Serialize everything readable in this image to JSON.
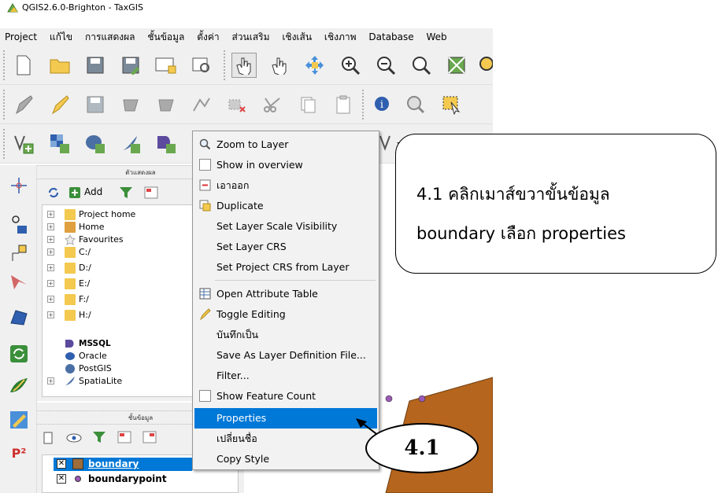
{
  "window": {
    "title": "QGIS2.6.0-Brighton - TaxGIS"
  },
  "menubar": {
    "items": [
      "Project",
      "แก้ไข",
      "การแสดงผล",
      "ชั้นข้อมูล",
      "ตั้งค่า",
      "ส่วนเสริม",
      "เชิงเส้น",
      "เชิงภาพ",
      "Database",
      "Web"
    ]
  },
  "browser": {
    "header": "ตัวแสดงผล",
    "add_label": "Add",
    "tree": [
      "Project home",
      "Home",
      "Favourites",
      "C:/",
      "D:/",
      "E:/",
      "F:/",
      "H:/",
      "MSSQL",
      "Oracle",
      "PostGIS",
      "SpatiaLite"
    ]
  },
  "layers": {
    "header": "ชั้นข้อมูล",
    "items": [
      {
        "name": "boundary",
        "checked": true,
        "selected": true
      },
      {
        "name": "boundarypoint",
        "checked": true,
        "selected": false
      }
    ]
  },
  "context_menu": {
    "items": [
      {
        "label": "Zoom to Layer",
        "icon": "zoom-icon"
      },
      {
        "label": "Show in overview",
        "icon": "checkbox"
      },
      {
        "label": "เอาออก",
        "icon": "remove-icon"
      },
      {
        "label": "Duplicate",
        "icon": "duplicate-icon"
      },
      {
        "label": "Set Layer Scale Visibility",
        "icon": ""
      },
      {
        "label": "Set Layer CRS",
        "icon": ""
      },
      {
        "label": "Set Project CRS from Layer",
        "icon": ""
      },
      {
        "label": "Open Attribute Table",
        "icon": "table-icon"
      },
      {
        "label": "Toggle Editing",
        "icon": "pencil-icon"
      },
      {
        "label": "บันทึกเป็น",
        "icon": ""
      },
      {
        "label": "Save As Layer Definition File...",
        "icon": ""
      },
      {
        "label": "Filter...",
        "icon": ""
      },
      {
        "label": "Show Feature Count",
        "icon": "checkbox"
      },
      {
        "label": "Properties",
        "icon": "",
        "highlighted": true
      },
      {
        "label": "เปลี่ยนชื่อ",
        "icon": ""
      },
      {
        "label": "Copy Style",
        "icon": ""
      }
    ]
  },
  "callout": {
    "line1": "4.1 คลิกเมาส์ขวาขั้นข้อมูล",
    "line2": "boundary เลือก properties"
  },
  "step_badge": "4.1",
  "colors": {
    "highlight": "#0078d7",
    "map_polygon": "#b5651d",
    "point": "#9b59b6"
  }
}
